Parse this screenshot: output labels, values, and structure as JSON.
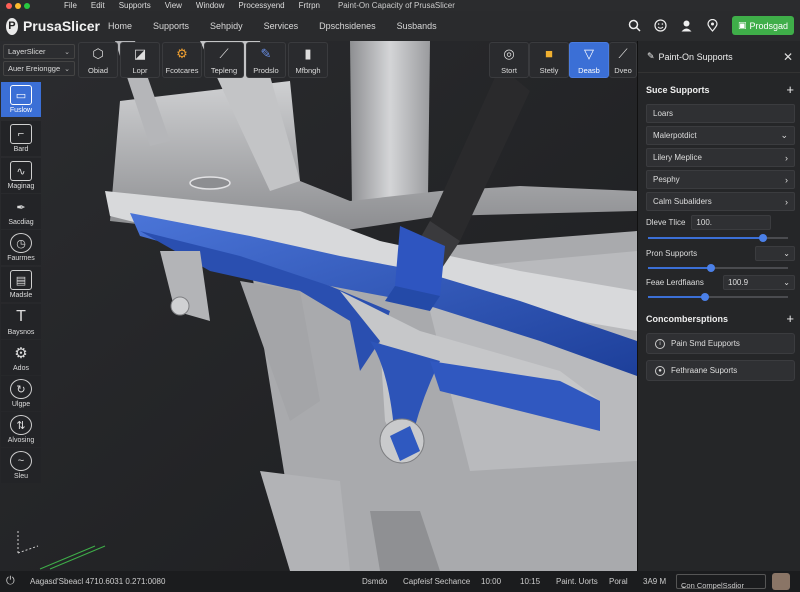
{
  "menubar": {
    "items": [
      "File",
      "Edit",
      "Supports",
      "View",
      "Window",
      "Processyend",
      "Frtrpn"
    ],
    "window_title": "Paint-On Capacity of PrusaSlicer"
  },
  "app": {
    "name": "PrusaSlicer",
    "logo_letter": "P"
  },
  "nav": {
    "links": [
      "Home",
      "Supports",
      "Sehpidy",
      "Services",
      "Dpschsidenes",
      "Susbands"
    ],
    "produced_label": "Prodsgad"
  },
  "viewport": {
    "dropdowns": [
      {
        "label": "LayerSlicer"
      },
      {
        "label": "Auer Ereiongge"
      }
    ],
    "toolbar_left": [
      {
        "label": "Obiad",
        "icon": "cube-icon"
      },
      {
        "label": "Lopr",
        "icon": "layer-icon"
      },
      {
        "label": "Fcotcares",
        "icon": "gears-icon"
      },
      {
        "label": "Tepleng",
        "icon": "brush-icon"
      },
      {
        "label": "Prodslo",
        "icon": "paint-icon"
      },
      {
        "label": "Mfbngh",
        "icon": "figure-icon"
      }
    ],
    "toolbar_right": [
      {
        "label": "Stort",
        "icon": "compass-icon",
        "active": false
      },
      {
        "label": "Stetly",
        "icon": "box-icon",
        "active": false
      },
      {
        "label": "Deasb",
        "icon": "funnel-icon",
        "active": true
      },
      {
        "label": "Dveo",
        "icon": "brush-icon",
        "active": false
      }
    ],
    "left_tools": [
      {
        "label": "Fuslow",
        "icon": "monitor-icon",
        "active": true
      },
      {
        "label": "Bard",
        "icon": "crop-icon"
      },
      {
        "label": "Maginag",
        "icon": "curve-icon"
      },
      {
        "label": "Sacdiag",
        "icon": "pen-icon"
      },
      {
        "label": "Faurmes",
        "icon": "timer-icon"
      },
      {
        "label": "Madsle",
        "icon": "grid-icon"
      },
      {
        "label": "Baysnos",
        "icon": "text-icon"
      },
      {
        "label": "Ados",
        "icon": "gear-icon"
      },
      {
        "label": "Ulgpe",
        "icon": "cycle-icon"
      },
      {
        "label": "Alvosing",
        "icon": "arrows-icon"
      },
      {
        "label": "Sleu",
        "icon": "swirl-icon"
      }
    ]
  },
  "panel": {
    "title": "Paint-On Supports",
    "section1": "Suce Supports",
    "items": [
      {
        "label": "Loars",
        "chevron": ""
      },
      {
        "label": "Malerpotdict",
        "chevron": "⌄"
      },
      {
        "label": "Lilery Meplice",
        "chevron": "›"
      },
      {
        "label": "Pesphy",
        "chevron": "›"
      },
      {
        "label": "Calm Subaliders",
        "chevron": "›"
      }
    ],
    "dveo_label": "Dleve Tlice",
    "dveo_value": "100.",
    "dveo_level": 0.82,
    "pron_label": "Pron Supports",
    "pron_level": 0.45,
    "face_label": "Feae Lerdfiaans",
    "face_value": "100.9",
    "face_level": 0.41,
    "section2": "Concombersptions",
    "buttons": [
      {
        "label": "Pain Smd Eupports"
      },
      {
        "label": "Fethraane Suports"
      }
    ]
  },
  "status": {
    "left": "Aagasd'Sbeacl 4710.6031 0.271:0080",
    "items": [
      "Dsmdo",
      "Capfeisf Sechance",
      "10:00",
      "10:15",
      "Paint. Uorts",
      "Poral",
      "3A9 M"
    ],
    "dropdown": "Con CompelSsdior"
  },
  "colors": {
    "accent": "#3b6fd6",
    "support_paint": "#2f59c0",
    "produce_green": "#3fae49",
    "model_gray": "#c9cacc"
  }
}
